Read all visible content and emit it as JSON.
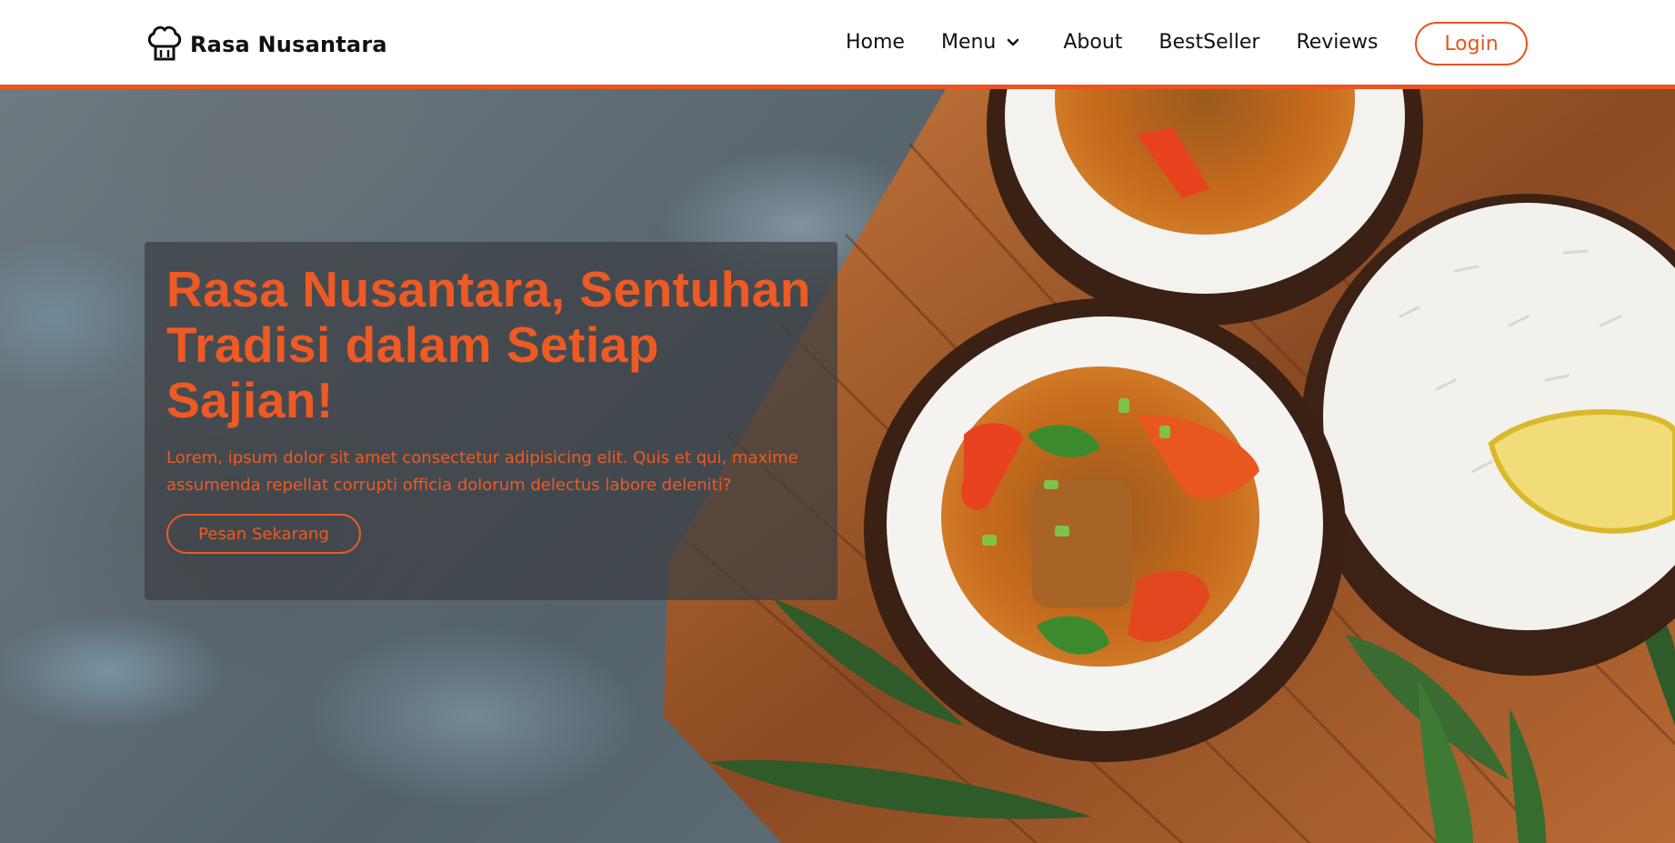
{
  "brand": {
    "name": "Rasa Nusantara",
    "logo_icon": "chef-hat-icon"
  },
  "nav": {
    "items": [
      {
        "label": "Home"
      },
      {
        "label": "Menu",
        "icon": "chevron-down-icon"
      },
      {
        "label": "About"
      },
      {
        "label": "BestSeller"
      },
      {
        "label": "Reviews"
      }
    ],
    "login_label": "Login"
  },
  "hero": {
    "title": "Rasa Nusantara, Sentuhan Tradisi dalam Setiap Sajian!",
    "description": "Lorem, ipsum dolor sit amet consectetur adipisicing elit. Quis et qui, maxime assumenda repellat corrupti officia dolorum delectus labore deleniti?",
    "cta_label": "Pesan Sekarang"
  },
  "colors": {
    "accent": "#e9541f",
    "text_dark": "#111111",
    "panel": "rgba(58,62,66,0.72)"
  }
}
